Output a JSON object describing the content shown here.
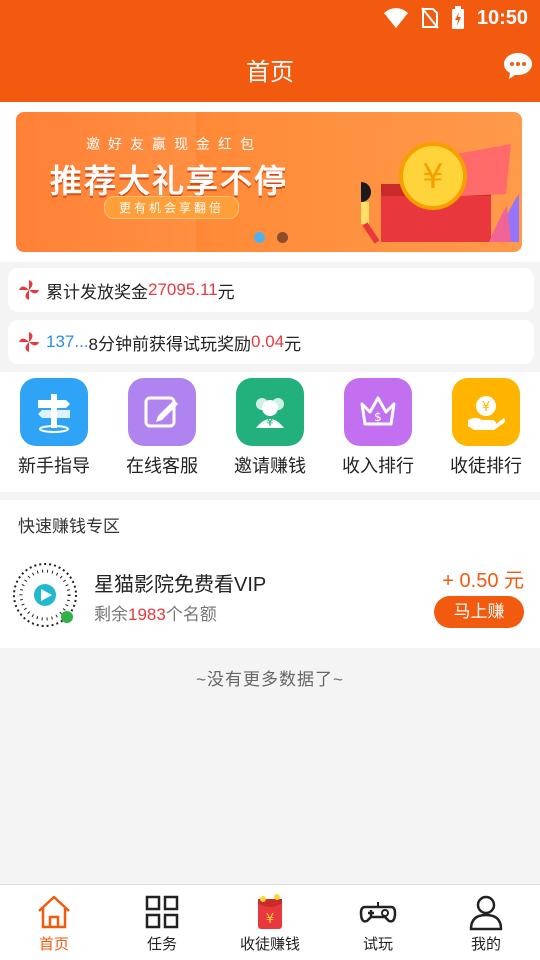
{
  "status": {
    "time": "10:50"
  },
  "header": {
    "title": "首页"
  },
  "banner": {
    "subtitle": "邀好友赢现金红包",
    "title": "推荐大礼享不停",
    "tagline": "更有机会享翻倍",
    "active_slide": 1,
    "slide_count": 2
  },
  "notices": {
    "total": {
      "prefix": "累计发放奖金",
      "amount": "27095.11",
      "unit": "元"
    },
    "recent": {
      "user": "137...",
      "text": "8分钟前获得试玩奖励",
      "amount": "0.04",
      "unit": "元"
    }
  },
  "shortcuts": [
    {
      "label": "新手指导",
      "icon": "signpost-icon",
      "color": "#2fa3f5"
    },
    {
      "label": "在线客服",
      "icon": "edit-icon",
      "color": "#b084f0"
    },
    {
      "label": "邀请赚钱",
      "icon": "users-icon",
      "color": "#22b07d"
    },
    {
      "label": "收入排行",
      "icon": "crown-icon",
      "color": "#c26ff0"
    },
    {
      "label": "收徒排行",
      "icon": "coin-hand-icon",
      "color": "#ffb400"
    }
  ],
  "quick_zone": {
    "title": "快速赚钱专区",
    "task": {
      "name": "星猫影院免费看VIP",
      "remain_prefix": "剩余",
      "remain_count": "1983",
      "remain_suffix": "个名额",
      "reward": "+ 0.50 元",
      "button": "马上赚"
    }
  },
  "list_end": "~没有更多数据了~",
  "tabbar": [
    {
      "label": "首页",
      "icon": "home-icon",
      "active": true
    },
    {
      "label": "任务",
      "icon": "grid-icon",
      "active": false
    },
    {
      "label": "收徒赚钱",
      "icon": "red-envelope-icon",
      "active": false
    },
    {
      "label": "试玩",
      "icon": "gamepad-icon",
      "active": false
    },
    {
      "label": "我的",
      "icon": "user-icon",
      "active": false
    }
  ],
  "colors": {
    "brand": "#f25a0f",
    "highlight": "#e8383d",
    "link": "#2d8cf0"
  }
}
